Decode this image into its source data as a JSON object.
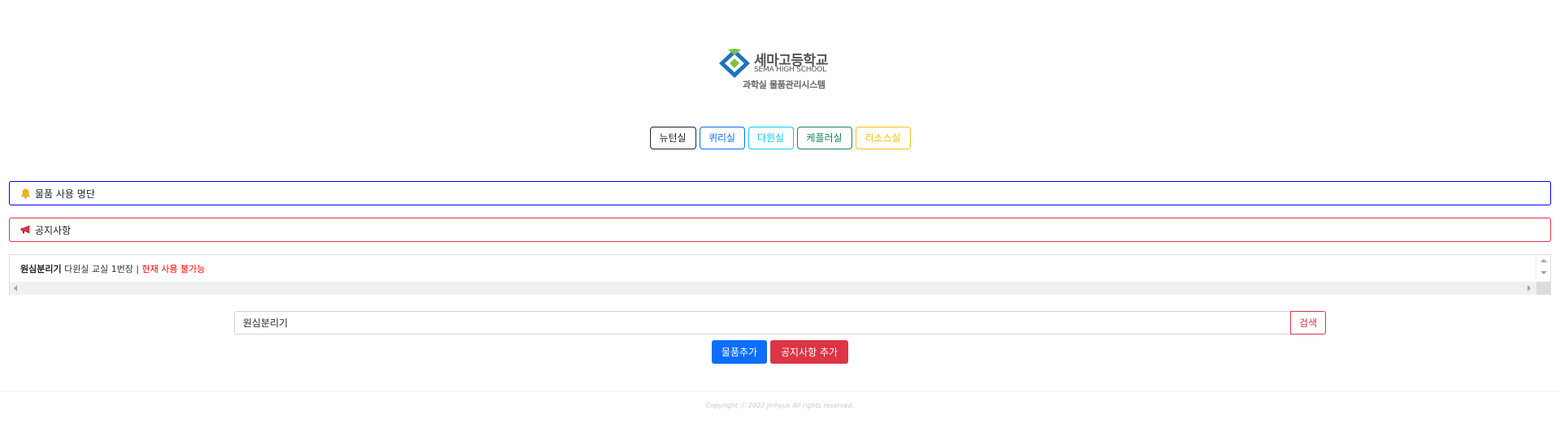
{
  "logo": {
    "school_name": "세마고등학교",
    "school_en": "SEMA HIGH SCHOOL",
    "system_name": "과학실 물품관리시스템",
    "colors": {
      "green": "#7cc242",
      "blue": "#1e73be"
    }
  },
  "labs": [
    {
      "label": "뉴턴실",
      "color": "#212529"
    },
    {
      "label": "퀴리실",
      "color": "#0d6efd"
    },
    {
      "label": "다윈실",
      "color": "#0dcaf0"
    },
    {
      "label": "케플러실",
      "color": "#198754"
    },
    {
      "label": "리소스실",
      "color": "#ffc107"
    }
  ],
  "usage_bar": {
    "icon": "bell-icon",
    "label": "물품 사용 명단"
  },
  "notice_bar": {
    "icon": "megaphone-icon",
    "label": "공지사항"
  },
  "ticker": {
    "item_name": "원심분리기",
    "item_location": " 다윈실 교실 1번장 | ",
    "item_status": "현재 사용 불가능"
  },
  "search": {
    "value": "원심분리기",
    "button_label": "검색"
  },
  "actions": {
    "add_item_label": "물품추가",
    "add_notice_label": "공지사항 추가"
  },
  "footer": {
    "text": "Copyright ⓒ 2022 jinhyuk All rights reserved."
  }
}
